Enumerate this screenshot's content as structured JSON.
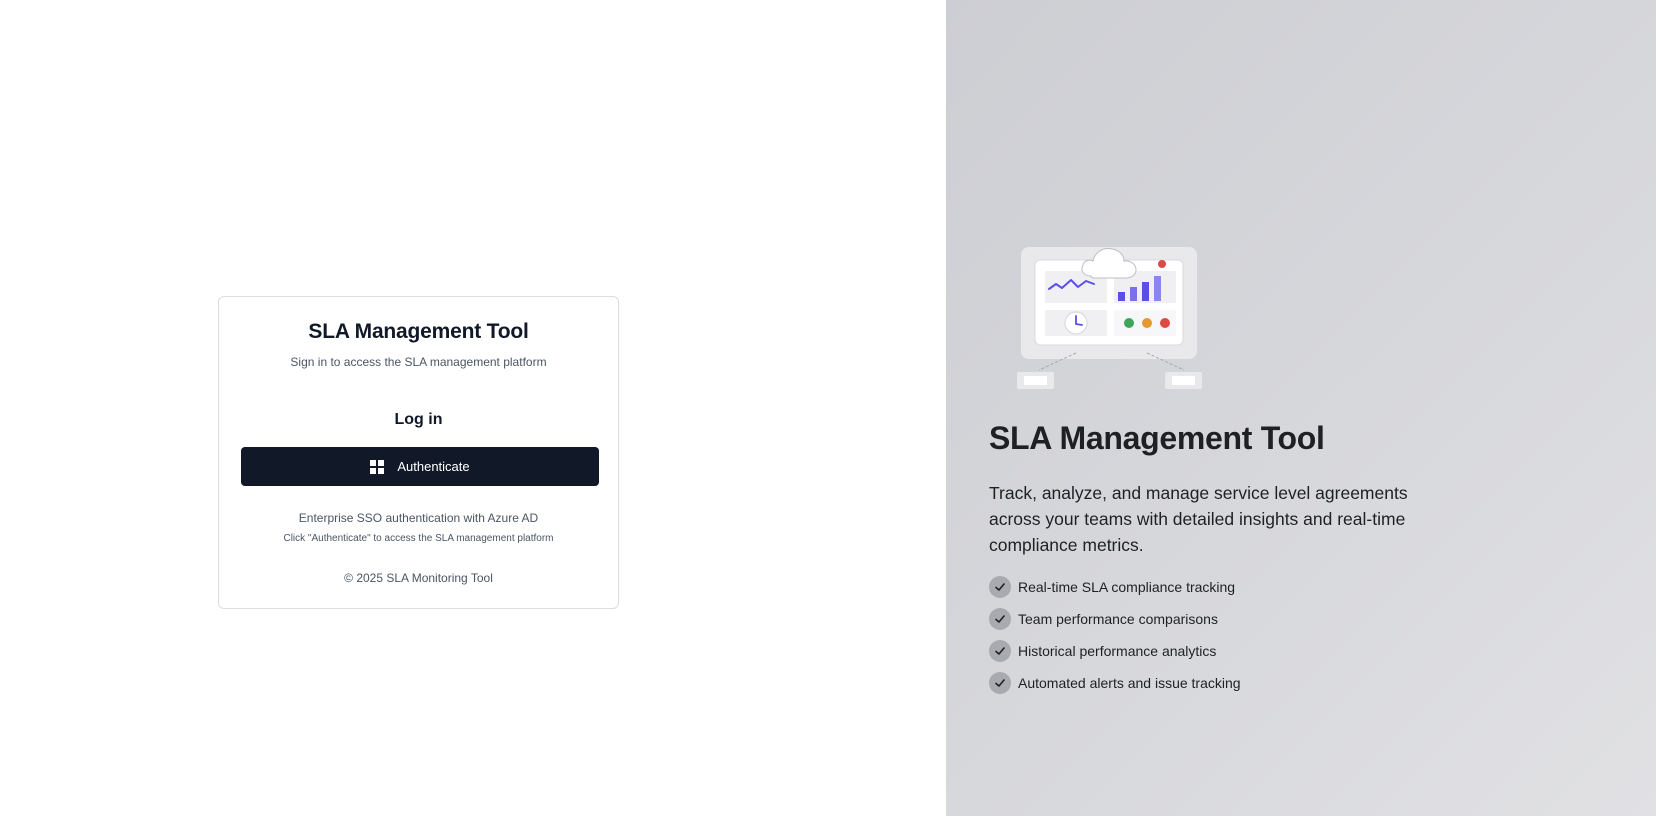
{
  "login": {
    "title": "SLA Management Tool",
    "subtitle": "Sign in to access the SLA management platform",
    "section_heading": "Log in",
    "authenticate_label": "Authenticate",
    "info": "Enterprise SSO authentication with Azure AD",
    "hint": "Click \"Authenticate\" to access the SLA management platform",
    "footer": "© 2025 SLA Monitoring Tool"
  },
  "hero": {
    "title": "SLA Management Tool",
    "description": "Track, analyze, and manage service level agreements across your teams with detailed insights and real-time compliance metrics.",
    "features": [
      {
        "label": "Real-time SLA compliance tracking",
        "icon": "check-icon"
      },
      {
        "label": "Team performance comparisons",
        "icon": "check-icon"
      },
      {
        "label": "Historical performance analytics",
        "icon": "check-icon"
      },
      {
        "label": "Automated alerts and issue tracking",
        "icon": "check-icon"
      }
    ]
  },
  "colors": {
    "button_bg": "#111827",
    "panel_bg": "#d4d5d9",
    "accent_purple": "#5b4fe6",
    "dot_green": "#3fa55b",
    "dot_orange": "#e49a2a",
    "dot_red": "#dc4a45"
  },
  "icons": {
    "auth_button": "windows-icon",
    "illustration": "dashboard-cloud-illustration"
  }
}
